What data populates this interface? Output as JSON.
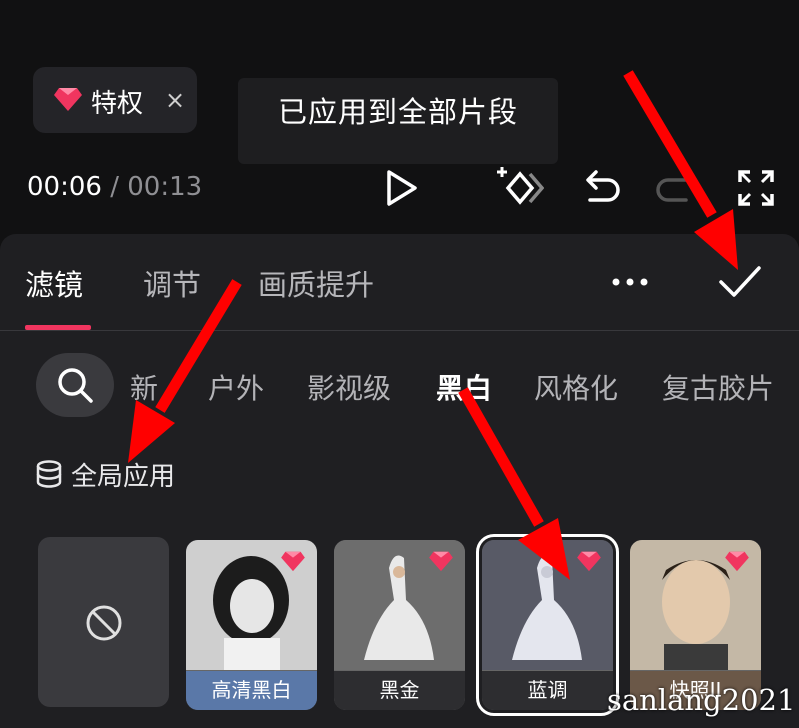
{
  "privilege_chip": {
    "label": "特权",
    "close": "×"
  },
  "toast": {
    "text": "已应用到全部片段"
  },
  "player": {
    "current_time": "00:06",
    "separator": "/",
    "total_time": "00:13"
  },
  "tabs": [
    {
      "label": "滤镜",
      "active": true
    },
    {
      "label": "调节",
      "active": false
    },
    {
      "label": "画质提升",
      "active": false
    }
  ],
  "categories": [
    {
      "label": "新",
      "active": false
    },
    {
      "label": "户外",
      "active": false
    },
    {
      "label": "影视级",
      "active": false
    },
    {
      "label": "黑白",
      "active": true
    },
    {
      "label": "风格化",
      "active": false
    },
    {
      "label": "复古胶片",
      "active": false
    }
  ],
  "global_apply": {
    "label": "全局应用"
  },
  "filters": [
    {
      "label": "高清黑白",
      "premium": true,
      "selected": false,
      "caption_color": "#5a78a8"
    },
    {
      "label": "黑金",
      "premium": true,
      "selected": false
    },
    {
      "label": "蓝调",
      "premium": true,
      "selected": true
    },
    {
      "label": "快照II",
      "premium": true,
      "selected": false
    }
  ],
  "watermark": "sanlang2021",
  "colors": {
    "accent": "#f0355f",
    "gem": "#f0355f",
    "arrow": "#ff0000",
    "panel": "#1f1f22"
  }
}
